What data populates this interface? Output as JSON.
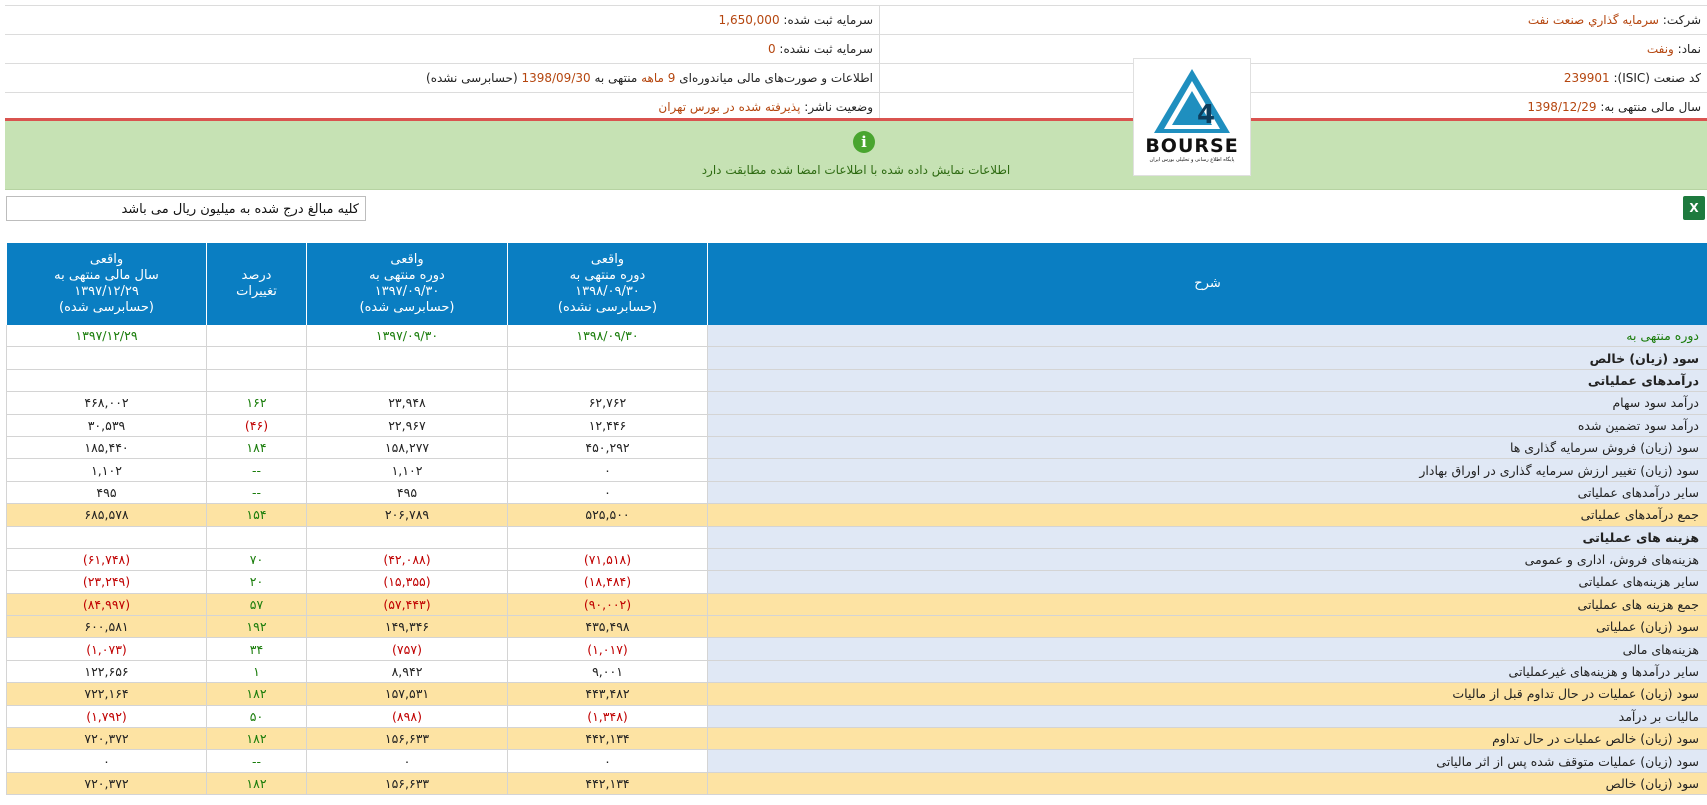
{
  "header": {
    "rows": [
      {
        "right_label": "شرکت:",
        "right_value": "سرمايه گذاري صنعت نفت",
        "left_label": "سرمایه ثبت شده:",
        "left_value": "1,650,000"
      },
      {
        "right_label": "نماد:",
        "right_value": "ونفت",
        "left_label": "سرمایه ثبت نشده:",
        "left_value": "0"
      },
      {
        "right_label": "کد صنعت (ISIC):",
        "right_value": "239901",
        "left_label": "اطلاعات و صورت‌های مالی میاندوره‌ای",
        "left_value": "9 ماهه",
        "left_suffix": "منتهی به",
        "left_date": "1398/09/30",
        "left_status": "(حسابرسی نشده)"
      },
      {
        "right_label": "سال مالی منتهی به:",
        "right_value": "1398/12/29",
        "left_label": "وضعیت ناشر:",
        "left_value": "پذیرفته شده در بورس تهران"
      }
    ]
  },
  "notice": {
    "icon": "info-icon",
    "text": "اطلاعات نمایش داده شده با اطلاعات امضا شده مطابقت دارد"
  },
  "logo": {
    "text": "BOURSE",
    "subtext": "پایگاه اطلاع رسانی و تحلیلی بورس ایران"
  },
  "note": "کلیه مبالغ درج شده به میلیون ریال می باشد",
  "table": {
    "headers": {
      "desc": "شرح",
      "p1": [
        "واقعی",
        "دوره منتهی به",
        "۱۳۹۸/۰۹/۳۰",
        "(حسابرسی نشده)"
      ],
      "p2": [
        "واقعی",
        "دوره منتهی به",
        "۱۳۹۷/۰۹/۳۰",
        "(حسابرسی شده)"
      ],
      "pct": [
        "درصد",
        "تغییرات"
      ],
      "fy": [
        "واقعی",
        "سال مالی منتهی به",
        "۱۳۹۷/۱۲/۲۹",
        "(حسابرسی شده)"
      ]
    },
    "rows": [
      {
        "desc": "دوره منتهی به",
        "p1": "۱۳۹۸/۰۹/۳۰",
        "p2": "۱۳۹۷/۰۹/۳۰",
        "pct": "",
        "fy": "۱۳۹۷/۱۲/۲۹",
        "type": "date"
      },
      {
        "desc": "سود (زیان) خالص",
        "p1": "",
        "p2": "",
        "pct": "",
        "fy": "",
        "type": "bold"
      },
      {
        "desc": "درآمدهای عملیاتی",
        "p1": "",
        "p2": "",
        "pct": "",
        "fy": "",
        "type": "bold"
      },
      {
        "desc": "درآمد سود سهام",
        "p1": "۶۲,۷۶۲",
        "p2": "۲۳,۹۴۸",
        "pct": "۱۶۲",
        "fy": "۴۶۸,۰۰۲",
        "type": ""
      },
      {
        "desc": "درآمد سود تضمین شده",
        "p1": "۱۲,۴۴۶",
        "p2": "۲۲,۹۶۷",
        "pct": "(۴۶)",
        "fy": "۳۰,۵۳۹",
        "type": ""
      },
      {
        "desc": "سود (زیان) فروش سرمایه گذاری ها",
        "p1": "۴۵۰,۲۹۲",
        "p2": "۱۵۸,۲۷۷",
        "pct": "۱۸۴",
        "fy": "۱۸۵,۴۴۰",
        "type": ""
      },
      {
        "desc": "سود (زیان) تغییر ارزش سرمایه گذاری در اوراق بهادار",
        "p1": "۰",
        "p2": "۱,۱۰۲",
        "pct": "--",
        "fy": "۱,۱۰۲",
        "type": ""
      },
      {
        "desc": "سایر درآمدهای عملیاتی",
        "p1": "۰",
        "p2": "۴۹۵",
        "pct": "--",
        "fy": "۴۹۵",
        "type": ""
      },
      {
        "desc": "جمع درآمدهای عملیاتی",
        "p1": "۵۲۵,۵۰۰",
        "p2": "۲۰۶,۷۸۹",
        "pct": "۱۵۴",
        "fy": "۶۸۵,۵۷۸",
        "type": "hl"
      },
      {
        "desc": "هزینه های عملیاتی",
        "p1": "",
        "p2": "",
        "pct": "",
        "fy": "",
        "type": "bold"
      },
      {
        "desc": "هزینه‌های فروش، اداری و عمومی",
        "p1": "(۷۱,۵۱۸)",
        "p2": "(۴۲,۰۸۸)",
        "pct": "۷۰",
        "fy": "(۶۱,۷۴۸)",
        "type": ""
      },
      {
        "desc": "سایر هزینه‌های عملیاتی",
        "p1": "(۱۸,۴۸۴)",
        "p2": "(۱۵,۳۵۵)",
        "pct": "۲۰",
        "fy": "(۲۳,۲۴۹)",
        "type": ""
      },
      {
        "desc": "جمع هزینه های عملیاتی",
        "p1": "(۹۰,۰۰۲)",
        "p2": "(۵۷,۴۴۳)",
        "pct": "۵۷",
        "fy": "(۸۴,۹۹۷)",
        "type": "hl"
      },
      {
        "desc": "سود (زیان) عملیاتی",
        "p1": "۴۳۵,۴۹۸",
        "p2": "۱۴۹,۳۴۶",
        "pct": "۱۹۲",
        "fy": "۶۰۰,۵۸۱",
        "type": "hl"
      },
      {
        "desc": "هزینه‌های مالی",
        "p1": "(۱,۰۱۷)",
        "p2": "(۷۵۷)",
        "pct": "۳۴",
        "fy": "(۱,۰۷۳)",
        "type": ""
      },
      {
        "desc": "سایر درآمدها و هزینه‌های غیرعملیاتی",
        "p1": "۹,۰۰۱",
        "p2": "۸,۹۴۲",
        "pct": "۱",
        "fy": "۱۲۲,۶۵۶",
        "type": ""
      },
      {
        "desc": "سود (زیان) عملیات در حال تداوم قبل از مالیات",
        "p1": "۴۴۳,۴۸۲",
        "p2": "۱۵۷,۵۳۱",
        "pct": "۱۸۲",
        "fy": "۷۲۲,۱۶۴",
        "type": "hl"
      },
      {
        "desc": "مالیات بر درآمد",
        "p1": "(۱,۳۴۸)",
        "p2": "(۸۹۸)",
        "pct": "۵۰",
        "fy": "(۱,۷۹۲)",
        "type": ""
      },
      {
        "desc": "سود (زیان) خالص عملیات در حال تداوم",
        "p1": "۴۴۲,۱۳۴",
        "p2": "۱۵۶,۶۳۳",
        "pct": "۱۸۲",
        "fy": "۷۲۰,۳۷۲",
        "type": "hl"
      },
      {
        "desc": "سود (زیان) عملیات متوقف شده پس از اثر مالیاتی",
        "p1": "۰",
        "p2": "۰",
        "pct": "--",
        "fy": "۰",
        "type": ""
      },
      {
        "desc": "سود (زیان) خالص",
        "p1": "۴۴۲,۱۳۴",
        "p2": "۱۵۶,۶۳۳",
        "pct": "۱۸۲",
        "fy": "۷۲۰,۳۷۲",
        "type": "hl"
      }
    ]
  },
  "colors": {
    "header_blue": "#0a7ec2",
    "highlight": "#fde3a3",
    "desc_bg": "#e0e8f5",
    "notice_bg": "#c6e2b4",
    "negative": "#c00000",
    "positive": "#1a7d0b",
    "value": "#b5460f"
  }
}
